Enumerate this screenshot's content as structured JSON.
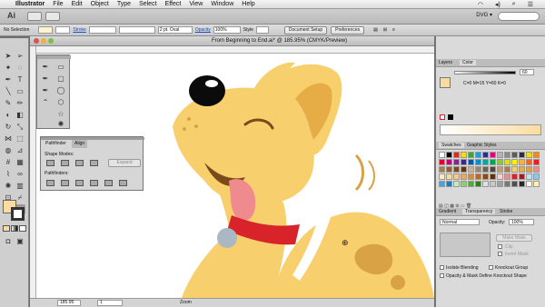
{
  "menu": {
    "app_name": "Illustrator",
    "items": [
      "File",
      "Edit",
      "Object",
      "Type",
      "Select",
      "Effect",
      "View",
      "Window",
      "Help"
    ]
  },
  "appbar": {
    "logo": "Ai",
    "workspace": "DVG"
  },
  "control": {
    "selection": "No Selection",
    "stroke_label": "Stroke",
    "brush": "2 pt. Oval",
    "opacity_label": "Opacity",
    "opacity_value": "100%",
    "style_label": "Style",
    "document_setup": "Document Setup",
    "preferences": "Preferences"
  },
  "document": {
    "title": "From Beginning to End.ai* @ 185.95% (CMYK/Preview)",
    "zoom": "185.95",
    "page": "1",
    "status": "Zoom"
  },
  "pathfinder": {
    "tabs": [
      "Pathfinder",
      "Align"
    ],
    "shape_modes_label": "Shape Modes:",
    "expand_label": "Expand",
    "pathfinders_label": "Pathfinders:"
  },
  "color_panel": {
    "tabs": [
      "Layers",
      "Color"
    ],
    "k_value": "60",
    "readout": "C=0 M=15 Y=60 K=0"
  },
  "swatches_panel": {
    "tabs": [
      "Swatches",
      "Graphic Styles"
    ]
  },
  "transparency_panel": {
    "tabs": [
      "Gradient",
      "Transparency",
      "Stroke"
    ],
    "blend_mode": "Normal",
    "opacity_label": "Opacity:",
    "opacity_value": "100%",
    "make_mask": "Make Mask",
    "clip": "Clip",
    "invert_mask": "Invert Mask",
    "isolate_blending": "Isolate Blending",
    "knockout_group": "Knockout Group",
    "opacity_mask_define": "Opacity & Mask Define Knockout Shape"
  },
  "colors": {
    "dog_fill": "#f7cf6c",
    "dog_shadow": "#e6ad47",
    "spots": "#d9a245",
    "collar": "#d8232a",
    "tongue": "#ef8a8f",
    "tag": "#a9b8c2",
    "swatch_current": "#fbdca0"
  },
  "swatch_colors": [
    "#ffffff",
    "#000000",
    "#e1261c",
    "#f7e000",
    "#38a935",
    "#1e9de0",
    "#2c2d8f",
    "#e3007e",
    "#b3b3b3",
    "#8c8c8c",
    "#5c5c5c",
    "#303030",
    "#ffde00",
    "#ff8c00",
    "#e4002b",
    "#c3007a",
    "#7f2b86",
    "#3a2a85",
    "#0057a8",
    "#0091c9",
    "#00a99d",
    "#00a650",
    "#8dc63f",
    "#d7df23",
    "#fff200",
    "#fbb040",
    "#f26522",
    "#ed1c24",
    "#a67c52",
    "#8c6239",
    "#754c24",
    "#603913",
    "#c7b299",
    "#998675",
    "#736357",
    "#534741",
    "#c69c6d",
    "#a67c52",
    "#f7cf6c",
    "#e6ad47",
    "#d9a245",
    "#ef8a8f",
    "#fde8c8",
    "#fbdca0",
    "#f7c98c",
    "#e8a860",
    "#d88a3a",
    "#b86a22",
    "#8a4a10",
    "#5e320a",
    "#f9d4d6",
    "#ef8a8f",
    "#d8232a",
    "#a11b20",
    "#bfe3f2",
    "#8cc9e8",
    "#4aa5d4",
    "#1f7cb8",
    "#c8e6c0",
    "#8fcc7c",
    "#4fae3b",
    "#2f7d22",
    "#e0e0e0",
    "#c8c8c8",
    "#a0a0a0",
    "#787878",
    "#505050",
    "#282828",
    "#fffbe6",
    "#fff0b3"
  ]
}
